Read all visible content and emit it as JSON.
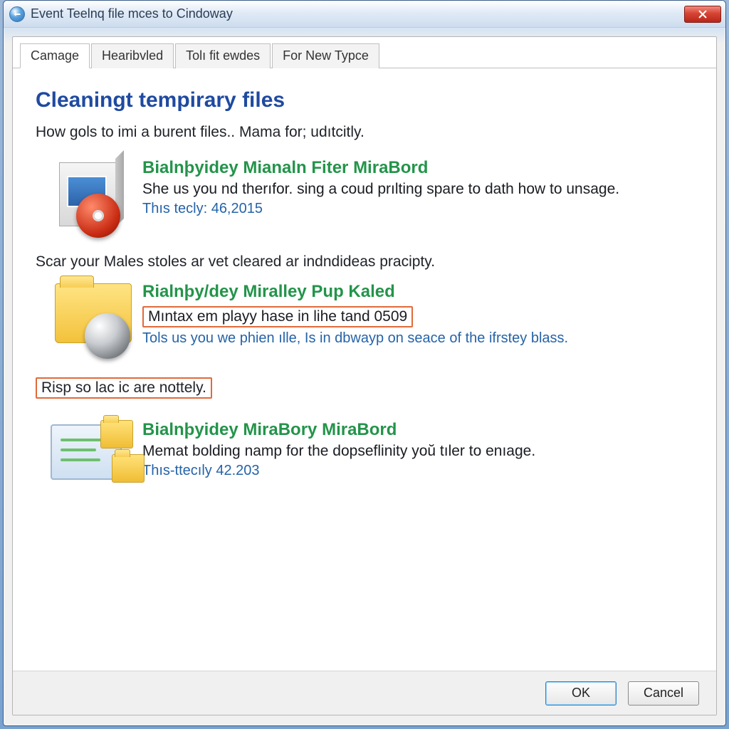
{
  "window": {
    "title": "Event Teelnq file mces to Cindoway"
  },
  "tabs": [
    {
      "label": "Camage",
      "active": true
    },
    {
      "label": "Hearibvled",
      "active": false
    },
    {
      "label": "Tolı fit ewdes",
      "active": false
    },
    {
      "label": "For New Typce",
      "active": false
    }
  ],
  "section": {
    "title": "Cleaningt tempirary files",
    "intro": "How gols to imi a burent files.. Mama for; udıtcitly."
  },
  "entries": [
    {
      "lead": "",
      "title": "Bialnþyidey Mianaln Fiter MiraBord",
      "desc": "She us you nd therıfor. sing a coud prılting spare to dath how to unsage.",
      "sub": "Thıs tecly: 46,2015",
      "hl_desc": false,
      "hl_lead": false
    },
    {
      "lead": "Scar your Males stoles ar vet cleared ar indndideas pracipty.",
      "title": "Rialnþy/dey Miralley Pup Kaled",
      "desc": "Mıntax em playy hase in lihe tand 0509",
      "sub": "Tols us you we phien ılle, Is in dbwayp on seace of the ifrstey blass.",
      "hl_desc": true,
      "hl_lead": false
    },
    {
      "lead": "Risp so lac ic are nottely.",
      "title": "Bialnþyidey MiraBory MiraBord",
      "desc": "Memat bolding namp for the dopseflinity yoŭ tıler to enıage.",
      "sub": "Thıs-ttecıly 42.203",
      "hl_desc": false,
      "hl_lead": true
    }
  ],
  "buttons": {
    "ok": "OK",
    "cancel": "Cancel"
  }
}
